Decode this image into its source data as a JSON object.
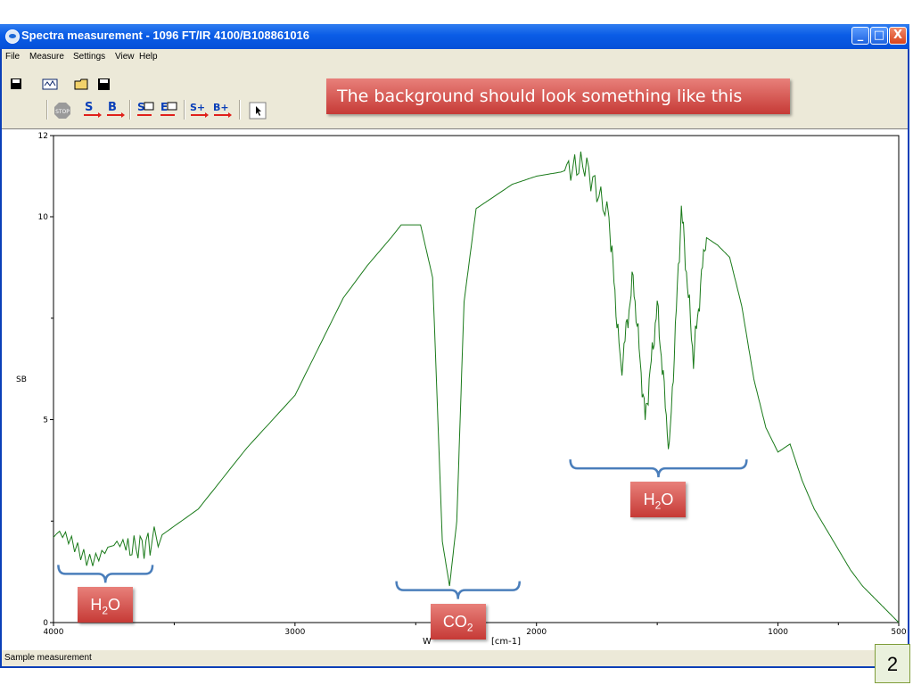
{
  "window": {
    "title": "Spectra measurement - 1096 FT/IR 4100/B108861016",
    "controls": [
      "_",
      "□",
      "X"
    ]
  },
  "menu": [
    "File",
    "Measure",
    "Settings",
    "View",
    "Help"
  ],
  "toolbar": {
    "row1": [
      "save-icon",
      "spectrum-icon",
      "open-folder-icon",
      "save-disk-icon"
    ],
    "row2": [
      "stop-button",
      "sample-measure-button",
      "background-measure-button",
      "sample-export-button",
      "export-button",
      "sample-add-button",
      "background-add-button",
      "pointer-button"
    ],
    "stop_label": "STOP",
    "sample_s": "S",
    "background_b": "B",
    "sample_add": "S+",
    "background_add": "B+",
    "export_e": "E"
  },
  "banner": "The background should look something like this",
  "chart_data": {
    "type": "line",
    "ylabel": "SB",
    "xlabel": "Wavenumber [cm-1]",
    "xlabel_visible_parts": [
      "W",
      "[cm-1]"
    ],
    "xlim": [
      4000,
      500
    ],
    "ylim": [
      0,
      12
    ],
    "x_ticks": [
      "4000",
      "3000",
      "2000",
      "1000",
      "500"
    ],
    "y_ticks": [
      "0",
      "5",
      "10",
      "12"
    ],
    "color": "#1a7a1a",
    "x": [
      4000,
      3850,
      3700,
      3600,
      3400,
      3200,
      3000,
      2900,
      2800,
      2700,
      2600,
      2560,
      2480,
      2430,
      2390,
      2360,
      2330,
      2300,
      2250,
      2200,
      2100,
      2000,
      1900,
      1800,
      1700,
      1650,
      1600,
      1550,
      1500,
      1450,
      1400,
      1350,
      1300,
      1250,
      1200,
      1150,
      1100,
      1050,
      1000,
      950,
      900,
      850,
      800,
      750,
      700,
      650,
      600,
      550,
      500
    ],
    "y": [
      2.1,
      1.7,
      1.8,
      1.95,
      2.8,
      4.3,
      5.6,
      6.8,
      8.0,
      8.8,
      9.5,
      9.8,
      9.8,
      8.5,
      2.0,
      0.9,
      2.5,
      7.9,
      10.2,
      10.4,
      10.8,
      11.0,
      11.1,
      11.3,
      10.0,
      6.2,
      8.5,
      5.0,
      7.8,
      4.2,
      10.2,
      6.5,
      9.5,
      9.3,
      9.0,
      7.8,
      6.0,
      4.8,
      4.2,
      4.4,
      3.5,
      2.8,
      2.3,
      1.8,
      1.3,
      0.9,
      0.6,
      0.3,
      0.0
    ],
    "annotations": [
      {
        "label": "H",
        "sub": "2",
        "tail": "O",
        "x_from": 3980,
        "x_to": 3590,
        "y": 1.2
      },
      {
        "label": "CO",
        "sub": "2",
        "tail": "",
        "x_from": 2580,
        "x_to": 2070,
        "y": 0.8
      },
      {
        "label": "H",
        "sub": "2",
        "tail": "O",
        "x_from": 1860,
        "x_to": 1130,
        "y": 3.8
      }
    ]
  },
  "status": "Sample measurement",
  "slide_number": "2"
}
